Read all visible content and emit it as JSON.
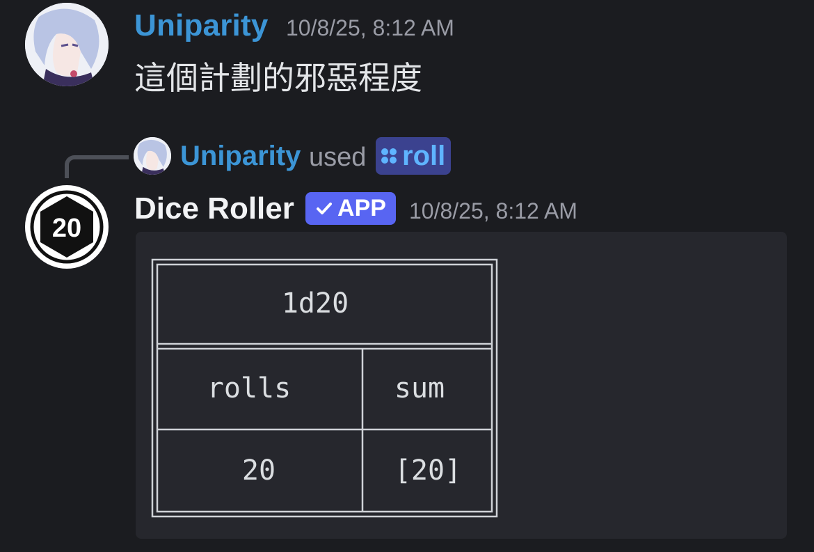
{
  "message1": {
    "username": "Uniparity",
    "timestamp": "10/8/25, 8:12 AM",
    "text": "這個計劃的邪惡程度"
  },
  "interaction": {
    "username": "Uniparity",
    "used_word": "used",
    "command": "roll"
  },
  "message2": {
    "bot_name": "Dice Roller",
    "badge": "APP",
    "timestamp": "10/8/25, 8:12 AM",
    "avatar_number": "20",
    "table": {
      "title": "1d20",
      "headers": [
        "rolls",
        "sum"
      ],
      "row": [
        "20",
        "[20]"
      ]
    }
  },
  "colors": {
    "background": "#1b1c20",
    "username": "#3c95d6",
    "accent_badge": "#5865f2",
    "command_chip": "#3b428f",
    "code_bg": "#26272d"
  },
  "icons": [
    "check-icon",
    "command-icon"
  ]
}
